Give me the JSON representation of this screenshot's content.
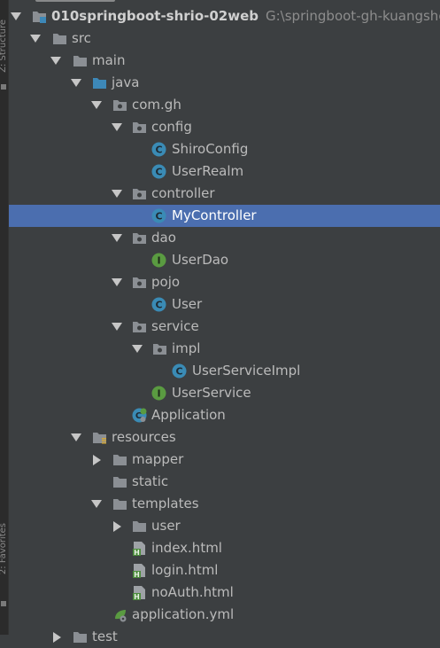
{
  "side_panel": {
    "structure_label": "Z: Structure",
    "favorites_label": "2: Favorites"
  },
  "tree": {
    "project": {
      "name": "010springboot-shrio-02web",
      "path": "G:\\springboot-gh-kuangshen\\"
    },
    "items": [
      {
        "label": "src"
      },
      {
        "label": "main"
      },
      {
        "label": "java"
      },
      {
        "label": "com.gh"
      },
      {
        "label": "config"
      },
      {
        "label": "ShiroConfig"
      },
      {
        "label": "UserRealm"
      },
      {
        "label": "controller"
      },
      {
        "label": "MyController"
      },
      {
        "label": "dao"
      },
      {
        "label": "UserDao"
      },
      {
        "label": "pojo"
      },
      {
        "label": "User"
      },
      {
        "label": "service"
      },
      {
        "label": "impl"
      },
      {
        "label": "UserServiceImpl"
      },
      {
        "label": "UserService"
      },
      {
        "label": "Application"
      },
      {
        "label": "resources"
      },
      {
        "label": "mapper"
      },
      {
        "label": "static"
      },
      {
        "label": "templates"
      },
      {
        "label": "user"
      },
      {
        "label": "index.html"
      },
      {
        "label": "login.html"
      },
      {
        "label": "noAuth.html"
      },
      {
        "label": "application.yml"
      },
      {
        "label": "test"
      }
    ],
    "icon_letters": {
      "class": "C",
      "interface": "I",
      "html": "H"
    }
  },
  "colors": {
    "background": "#3c3f41",
    "selection": "#4b6eaf",
    "folder": "#8b8f94",
    "source_folder": "#3d88b8",
    "class_icon": "#3a8bb5",
    "interface_icon": "#5a9b41",
    "html_badge": "#4a8a3a",
    "text": "#bbbbbb"
  }
}
